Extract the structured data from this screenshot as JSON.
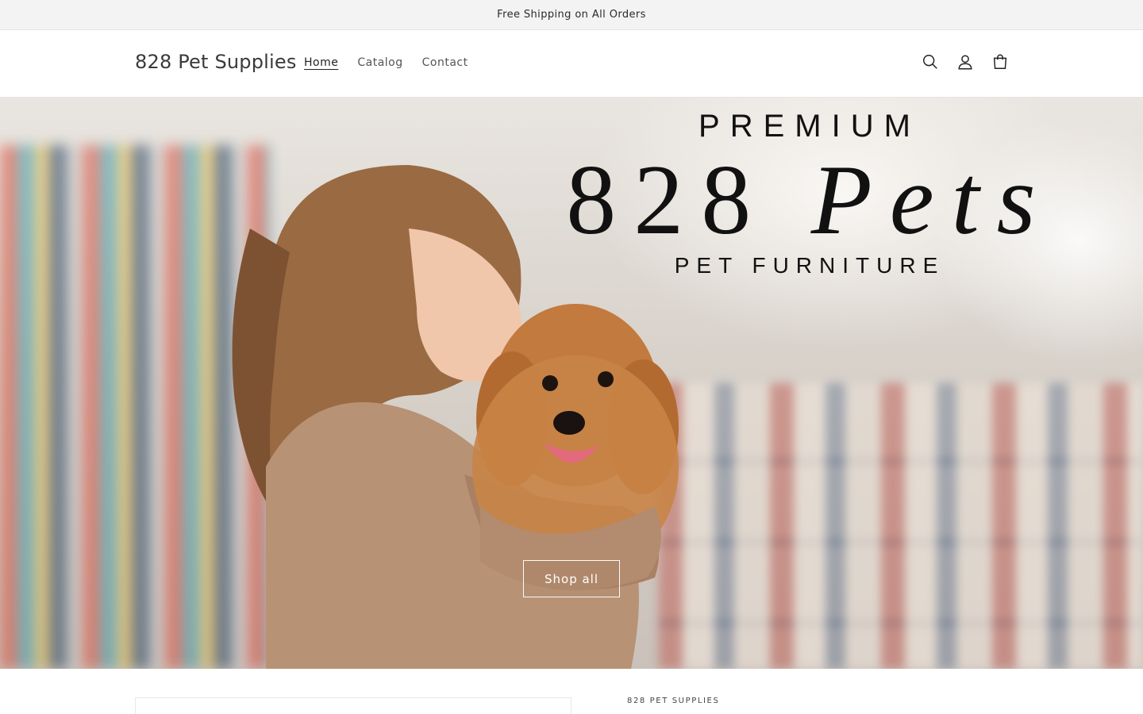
{
  "announcement": {
    "text": "Free Shipping on All Orders"
  },
  "header": {
    "logo": "828 Pet Supplies",
    "nav": [
      {
        "label": "Home",
        "active": true
      },
      {
        "label": "Catalog",
        "active": false
      },
      {
        "label": "Contact",
        "active": false
      }
    ],
    "icons": [
      "search-icon",
      "account-icon",
      "cart-icon"
    ]
  },
  "hero": {
    "eyebrow": "PREMIUM",
    "brand_number": "828",
    "brand_word": "Pets",
    "subtitle": "PET FURNITURE",
    "button_label": "Shop all"
  },
  "product_section": {
    "vendor": "828 PET SUPPLIES"
  },
  "colors": {
    "announcement_bg": "#f3f3f3",
    "text": "#121212",
    "hero_button_border": "#ffffff"
  }
}
